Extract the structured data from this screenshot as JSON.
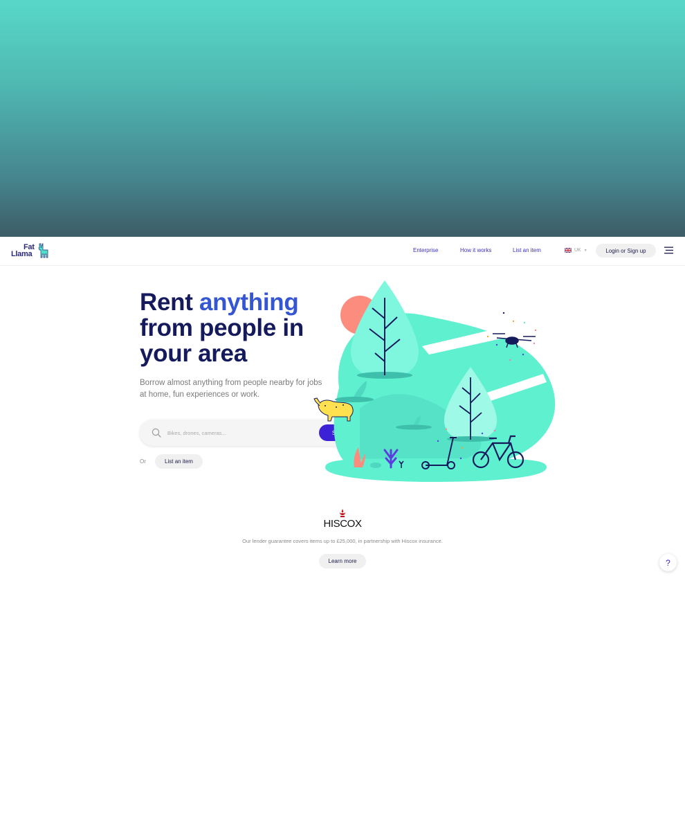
{
  "brand": {
    "logo_line1": "Fat",
    "logo_line2": "Llama"
  },
  "nav": {
    "links": [
      {
        "label": "Enterprise"
      },
      {
        "label": "How it works"
      },
      {
        "label": "List an item"
      }
    ],
    "locale": "UK",
    "login_label": "Login or Sign up"
  },
  "hero": {
    "title_word1": "Rent",
    "title_accent": "anything",
    "title_rest": "from people in your area",
    "subtitle": "Borrow almost anything from people nearby for jobs at home, fun experiences or work.",
    "search_placeholder": "Bikes, drones, cameras...",
    "search_button": "Search",
    "or_text": "Or",
    "list_button": "List an item"
  },
  "partner": {
    "name": "HISCOX",
    "text": "Our lender guarantee covers items up to £25,000, in partnership with Hiscox insurance.",
    "learn_more": "Learn more"
  },
  "help_label": "?",
  "colors": {
    "accent": "#3b22d6",
    "title_navy": "#141a5c",
    "title_blue": "#3556d3",
    "mint": "#5ff0cf",
    "band_top": "#58d8c9",
    "band_bottom": "#3d5c66"
  },
  "icons": [
    "llama-icon",
    "uk-flag-icon",
    "chevron-down-icon",
    "hamburger-menu-icon",
    "search-icon",
    "help-icon",
    "hiscox-crest-icon"
  ]
}
